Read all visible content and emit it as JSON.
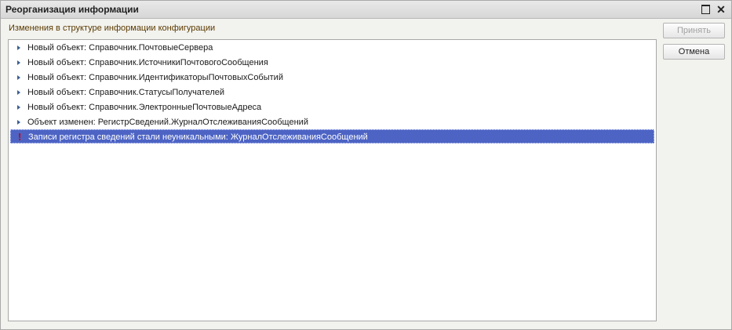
{
  "window": {
    "title": "Реорганизация информации"
  },
  "caption": "Изменения в структуре информации конфигурации",
  "buttons": {
    "accept": "Принять",
    "cancel": "Отмена"
  },
  "items": [
    {
      "icon": "expand-triangle-icon",
      "text": "Новый объект: Справочник.ПочтовыеСервера"
    },
    {
      "icon": "expand-triangle-icon",
      "text": "Новый объект: Справочник.ИсточникиПочтовогоСообщения"
    },
    {
      "icon": "expand-triangle-icon",
      "text": "Новый объект: Справочник.ИдентификаторыПочтовыхСобытий"
    },
    {
      "icon": "expand-triangle-icon",
      "text": "Новый объект: Справочник.СтатусыПолучателей"
    },
    {
      "icon": "expand-triangle-icon",
      "text": "Новый объект: Справочник.ЭлектронныеПочтовыеАдреса"
    },
    {
      "icon": "expand-triangle-icon",
      "text": "Объект изменен: РегистрСведений.ЖурналОтслеживанияСообщений"
    },
    {
      "icon": "warning-exclamation-icon",
      "text": "Записи регистра сведений стали неуникальными: ЖурналОтслеживанияСообщений",
      "selected": true
    }
  ]
}
